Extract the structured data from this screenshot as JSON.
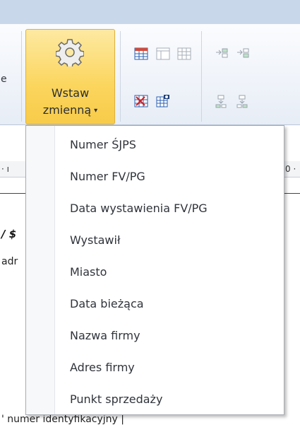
{
  "ribbon": {
    "cut_text": "e",
    "insert_button": {
      "line1": "Wstaw",
      "line2": "zmienną",
      "caret": "▾",
      "icon": "gear-icon"
    },
    "icons": [
      "table-icon",
      "table-outline-icon",
      "table-grid-icon",
      "merge-right-icon",
      "merge-right-alt-icon",
      "table-delete-icon",
      "table-properties-icon",
      "split-down-icon",
      "split-down-alt-icon"
    ]
  },
  "ruler": {
    "left_mark": "· ı",
    "right_mark": "0 ·"
  },
  "document": {
    "heading_fragment": "/ $",
    "field_fragment": "adr",
    "bottom_fragment": "' numer identyfikacyjny  |"
  },
  "dropdown": {
    "items": [
      {
        "label": "Numer ŚJPS"
      },
      {
        "label": "Numer FV/PG"
      },
      {
        "label": "Data wystawienia FV/PG"
      },
      {
        "label": "Wystawił"
      },
      {
        "label": "Miasto"
      },
      {
        "label": "Data bieżąca"
      },
      {
        "label": "Nazwa firmy"
      },
      {
        "label": "Adres firmy"
      },
      {
        "label": "Punkt sprzedaży"
      }
    ]
  },
  "colors": {
    "ribbon_top": "#c9d7ea",
    "button_highlight": "#fbd55d",
    "menu_text": "#30343b"
  }
}
